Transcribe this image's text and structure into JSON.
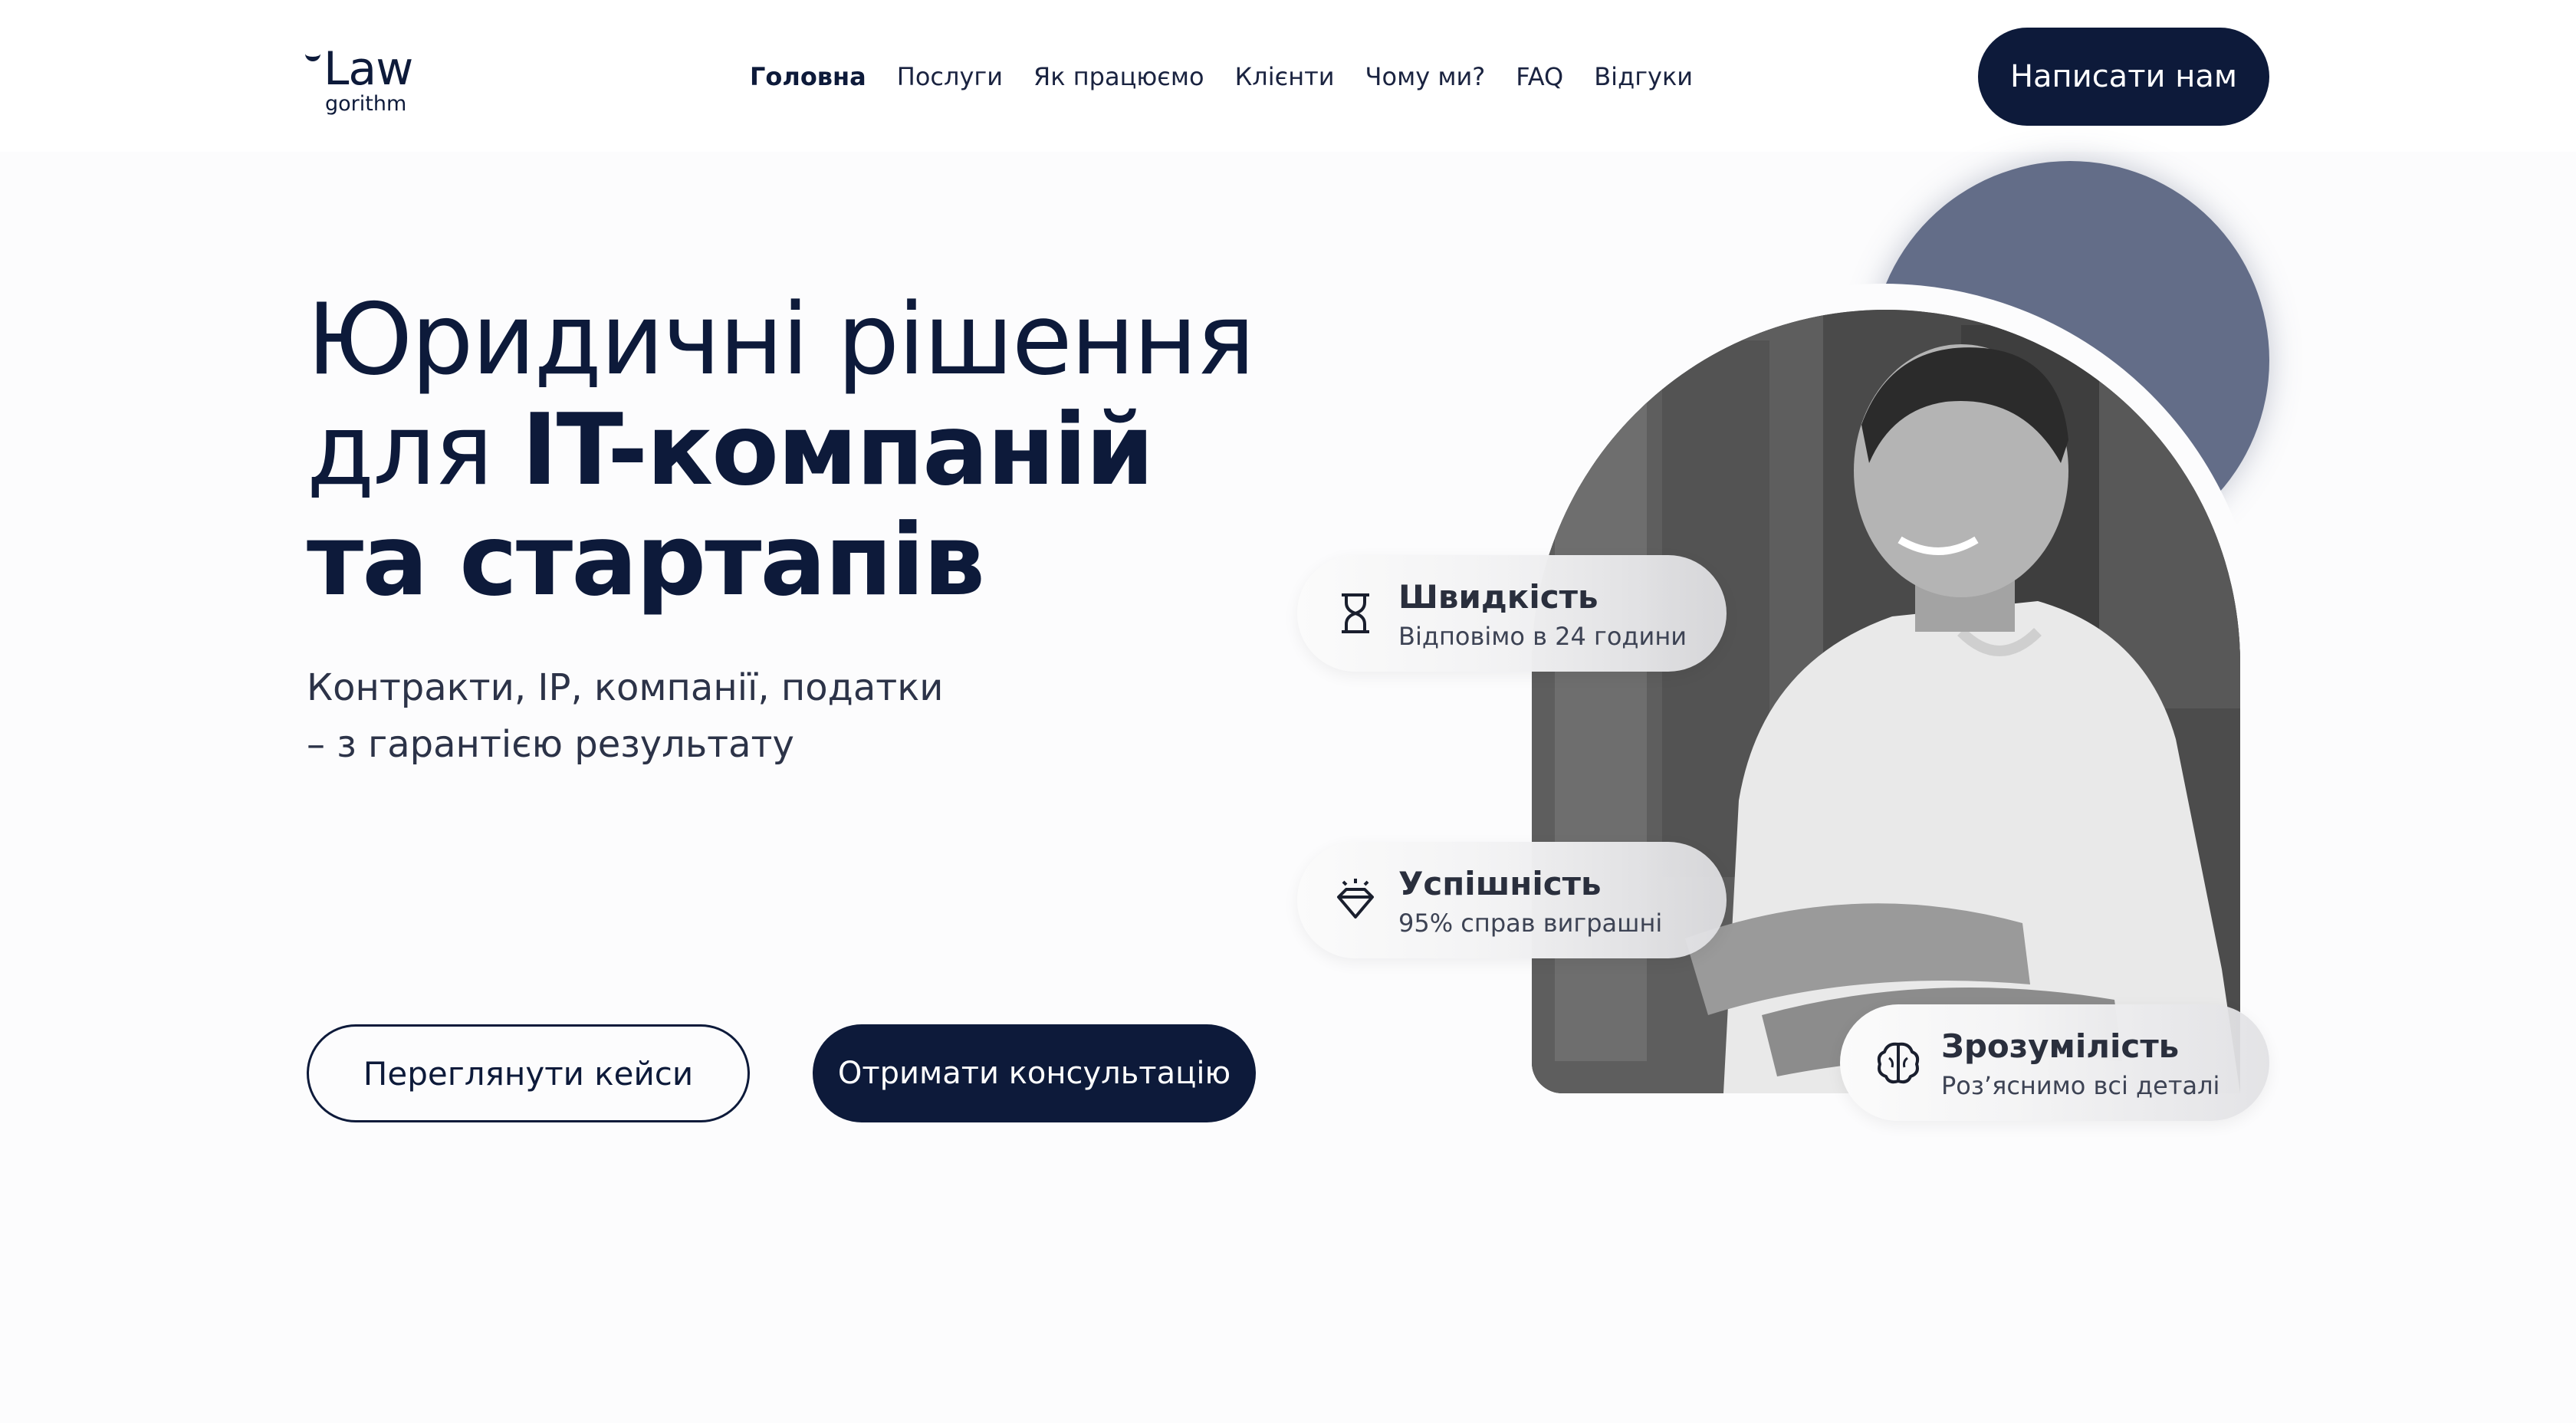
{
  "header": {
    "logo": {
      "top": "Law",
      "bottom": "gorithm"
    },
    "nav": [
      {
        "label": "Головна",
        "active": true
      },
      {
        "label": "Послуги",
        "active": false
      },
      {
        "label": "Як працюємо",
        "active": false
      },
      {
        "label": "Клієнти",
        "active": false
      },
      {
        "label": "Чому ми?",
        "active": false
      },
      {
        "label": "FAQ",
        "active": false
      },
      {
        "label": "Відгуки",
        "active": false
      }
    ],
    "cta_label": "Написати нам"
  },
  "hero": {
    "title_line1": "Юридичні рішення",
    "title_line2_light": "для ",
    "title_line2_bold": "IT-компаній",
    "title_line3": "та стартапів",
    "subtitle_line1": "Контракти, IP, компанії, податки",
    "subtitle_line2": "– з гарантією результату",
    "btn_cases": "Переглянути кейси",
    "btn_consult": "Отримати консультацію"
  },
  "features": [
    {
      "title": "Швидкість",
      "desc": "Відповімо в 24 години",
      "icon": "hourglass-icon"
    },
    {
      "title": "Успішність",
      "desc": "95% справ виграшні",
      "icon": "diamond-icon"
    },
    {
      "title": "Зрозумілість",
      "desc": "Роз’яснимо всі деталі",
      "icon": "brain-icon"
    }
  ],
  "colors": {
    "navy": "#0d1a3a",
    "circle": "#636d88",
    "background": "#fcfcfd"
  }
}
